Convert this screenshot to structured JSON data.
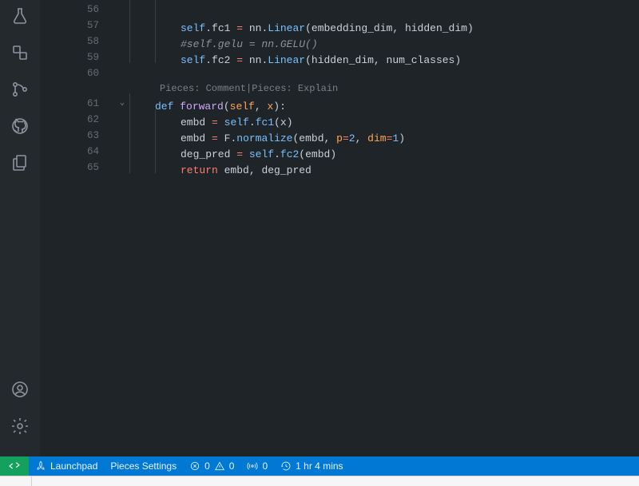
{
  "code": {
    "codelens": {
      "comment": "Pieces: Comment",
      "explain": "Pieces: Explain",
      "sep": " | "
    },
    "lines": [
      {
        "n": "56",
        "indent": 2,
        "tokens": []
      },
      {
        "n": "57",
        "indent": 2,
        "tokens": [
          {
            "t": "self",
            "c": "self"
          },
          {
            "t": "punc",
            "c": "."
          },
          {
            "t": "prop",
            "c": "fc1"
          },
          {
            "t": "var",
            "c": " "
          },
          {
            "t": "op",
            "c": "="
          },
          {
            "t": "var",
            "c": " nn"
          },
          {
            "t": "punc",
            "c": "."
          },
          {
            "t": "call",
            "c": "Linear"
          },
          {
            "t": "punc",
            "c": "("
          },
          {
            "t": "var",
            "c": "embedding_dim"
          },
          {
            "t": "punc",
            "c": ", "
          },
          {
            "t": "var",
            "c": "hidden_dim"
          },
          {
            "t": "punc",
            "c": ")"
          }
        ]
      },
      {
        "n": "58",
        "indent": 2,
        "tokens": [
          {
            "t": "comment",
            "c": "#self.gelu = nn.GELU()"
          }
        ]
      },
      {
        "n": "59",
        "indent": 2,
        "tokens": [
          {
            "t": "self",
            "c": "self"
          },
          {
            "t": "punc",
            "c": "."
          },
          {
            "t": "prop",
            "c": "fc2"
          },
          {
            "t": "var",
            "c": " "
          },
          {
            "t": "op",
            "c": "="
          },
          {
            "t": "var",
            "c": " nn"
          },
          {
            "t": "punc",
            "c": "."
          },
          {
            "t": "call",
            "c": "Linear"
          },
          {
            "t": "punc",
            "c": "("
          },
          {
            "t": "var",
            "c": "hidden_dim"
          },
          {
            "t": "punc",
            "c": ", "
          },
          {
            "t": "var",
            "c": "num_classes"
          },
          {
            "t": "punc",
            "c": ")"
          }
        ]
      },
      {
        "n": "60",
        "indent": 0,
        "tokens": []
      },
      {
        "codelens": true
      },
      {
        "n": "61",
        "indent": 1,
        "fold": true,
        "tokens": [
          {
            "t": "kw2",
            "c": "def"
          },
          {
            "t": "var",
            "c": " "
          },
          {
            "t": "func",
            "c": "forward"
          },
          {
            "t": "punc",
            "c": "("
          },
          {
            "t": "param",
            "c": "self"
          },
          {
            "t": "punc",
            "c": ", "
          },
          {
            "t": "param",
            "c": "x"
          },
          {
            "t": "punc",
            "c": ")"
          },
          {
            "t": "punc",
            "c": ":"
          }
        ]
      },
      {
        "n": "62",
        "indent": 2,
        "tokens": [
          {
            "t": "var",
            "c": "embd"
          },
          {
            "t": "var",
            "c": " "
          },
          {
            "t": "op",
            "c": "="
          },
          {
            "t": "var",
            "c": " "
          },
          {
            "t": "self",
            "c": "self"
          },
          {
            "t": "punc",
            "c": "."
          },
          {
            "t": "call",
            "c": "fc1"
          },
          {
            "t": "punc",
            "c": "("
          },
          {
            "t": "var",
            "c": "x"
          },
          {
            "t": "punc",
            "c": ")"
          }
        ]
      },
      {
        "n": "63",
        "indent": 2,
        "tokens": [
          {
            "t": "var",
            "c": "embd"
          },
          {
            "t": "var",
            "c": " "
          },
          {
            "t": "op",
            "c": "="
          },
          {
            "t": "var",
            "c": " F"
          },
          {
            "t": "punc",
            "c": "."
          },
          {
            "t": "call",
            "c": "normalize"
          },
          {
            "t": "punc",
            "c": "("
          },
          {
            "t": "var",
            "c": "embd"
          },
          {
            "t": "punc",
            "c": ", "
          },
          {
            "t": "param",
            "c": "p"
          },
          {
            "t": "op",
            "c": "="
          },
          {
            "t": "num",
            "c": "2"
          },
          {
            "t": "punc",
            "c": ", "
          },
          {
            "t": "param",
            "c": "dim"
          },
          {
            "t": "op",
            "c": "="
          },
          {
            "t": "num",
            "c": "1"
          },
          {
            "t": "punc",
            "c": ")"
          }
        ]
      },
      {
        "n": "64",
        "indent": 2,
        "tokens": [
          {
            "t": "var",
            "c": "deg_pred"
          },
          {
            "t": "var",
            "c": " "
          },
          {
            "t": "op",
            "c": "="
          },
          {
            "t": "var",
            "c": " "
          },
          {
            "t": "self",
            "c": "self"
          },
          {
            "t": "punc",
            "c": "."
          },
          {
            "t": "call",
            "c": "fc2"
          },
          {
            "t": "punc",
            "c": "("
          },
          {
            "t": "var",
            "c": "embd"
          },
          {
            "t": "punc",
            "c": ")"
          }
        ]
      },
      {
        "n": "65",
        "indent": 2,
        "tokens": [
          {
            "t": "kw",
            "c": "return"
          },
          {
            "t": "var",
            "c": " embd"
          },
          {
            "t": "punc",
            "c": ", "
          },
          {
            "t": "var",
            "c": "deg_pred"
          }
        ]
      }
    ]
  },
  "status": {
    "launchpad": "Launchpad",
    "pieces_settings": "Pieces Settings",
    "errors": "0",
    "warnings": "0",
    "ports": "0",
    "time": "1 hr 4 mins"
  }
}
